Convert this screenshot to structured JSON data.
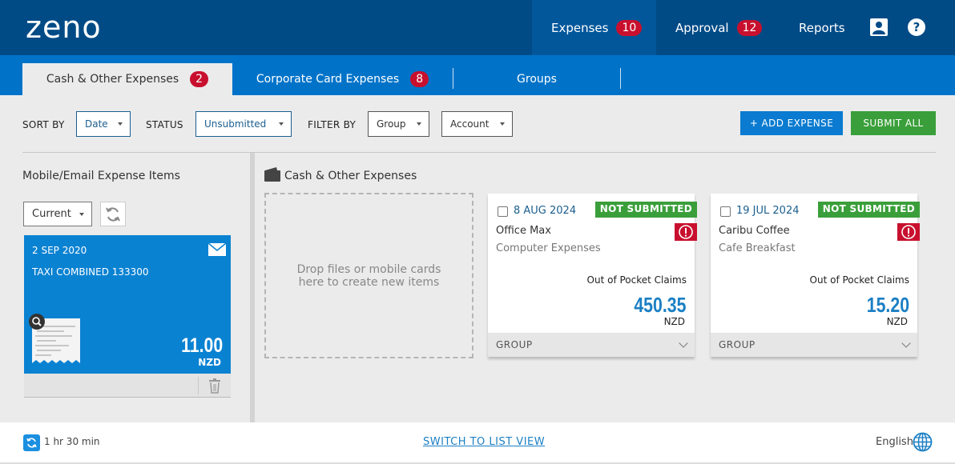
{
  "app": {
    "logo": "zeno"
  },
  "topnav": {
    "expenses": {
      "label": "Expenses",
      "count": "10"
    },
    "approval": {
      "label": "Approval",
      "count": "12"
    },
    "reports": {
      "label": "Reports"
    },
    "icons": [
      "user-icon",
      "help-icon"
    ]
  },
  "tabs": [
    {
      "label": "Cash & Other Expenses",
      "count": "2"
    },
    {
      "label": "Corporate Card Expenses",
      "count": "8"
    },
    {
      "label": "Groups"
    }
  ],
  "filters": {
    "sort_by_label": "SORT BY",
    "sort_by_value": "Date",
    "status_label": "STATUS",
    "status_value": "Unsubmitted",
    "filter_by_label": "FILTER BY",
    "group_value": "Group",
    "account_value": "Account"
  },
  "actions": {
    "add_expense": "+ ADD EXPENSE",
    "submit_all": "SUBMIT ALL"
  },
  "colors": {
    "accent": "#0a82d2",
    "header": "#004b86",
    "success": "#3a9f3a",
    "danger": "#c8102e"
  },
  "left_panel": {
    "title": "Mobile/Email Expense Items",
    "current_select": "Current",
    "items": [
      {
        "date": "2 SEP 2020",
        "description": "TAXI COMBINED 133300",
        "amount": "11.00",
        "currency": "NZD"
      }
    ]
  },
  "main": {
    "title": "Cash & Other Expenses",
    "dropzone_line1": "Drop files or mobile cards",
    "dropzone_line2": "here to create new items",
    "expenses": [
      {
        "date": "8 AUG 2024",
        "status": "NOT SUBMITTED",
        "merchant": "Office Max",
        "category": "Computer Expenses",
        "account": "Out of Pocket Claims",
        "amount": "450.35",
        "currency": "NZD",
        "group_label": "GROUP"
      },
      {
        "date": "19 JUL 2024",
        "status": "NOT SUBMITTED",
        "merchant": "Caribu Coffee",
        "category": "Cafe Breakfast",
        "account": "Out of Pocket Claims",
        "amount": "15.20",
        "currency": "NZD",
        "group_label": "GROUP"
      }
    ]
  },
  "footer": {
    "sync_time": "1 hr 30 min",
    "switch_view": "SWITCH TO LIST VIEW",
    "language": "English"
  }
}
